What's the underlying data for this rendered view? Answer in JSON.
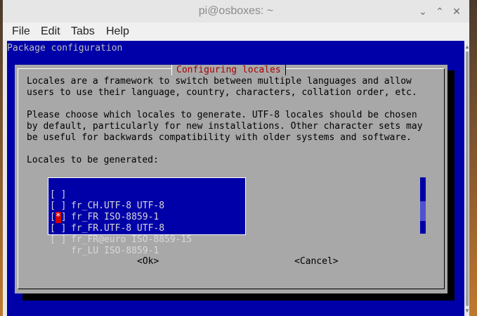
{
  "window": {
    "title": "pi@osboxes: ~"
  },
  "window_controls": {
    "minimize": "⌄",
    "maximize": "⌃",
    "close": "✕"
  },
  "menu": [
    "File",
    "Edit",
    "Tabs",
    "Help"
  ],
  "terminal": {
    "header": "Package configuration",
    "dialog": {
      "title": "Configuring locales",
      "paragraph1": [
        "Locales are a framework to switch between multiple languages and allow",
        "users to use their language, country, characters, collation order, etc."
      ],
      "paragraph2": [
        "Please choose which locales to generate. UTF-8 locales should be chosen",
        "by default, particularly for new installations. Other character sets may",
        "be useful for backwards compatibility with older systems and software."
      ],
      "prompt": "Locales to be generated:",
      "locales": [
        {
          "check": "[ ]",
          "label": "fr_CH.UTF-8 UTF-8"
        },
        {
          "check": "[ ]",
          "label": "fr_FR ISO-8859-1"
        },
        {
          "check": "[*]",
          "label": "fr_FR.UTF-8 UTF-8"
        },
        {
          "check": "[ ]",
          "label": "fr_FR@euro ISO-8859-15"
        },
        {
          "check": "[ ]",
          "label": "fr_LU ISO-8859-1"
        }
      ],
      "ok_button": "<Ok>",
      "cancel_button": "<Cancel>"
    }
  },
  "colors": {
    "terminal_bg": "#0000a8",
    "dialog_bg": "#a8a8a8",
    "title_red": "#a80000",
    "selected_marker": "#d00000"
  }
}
